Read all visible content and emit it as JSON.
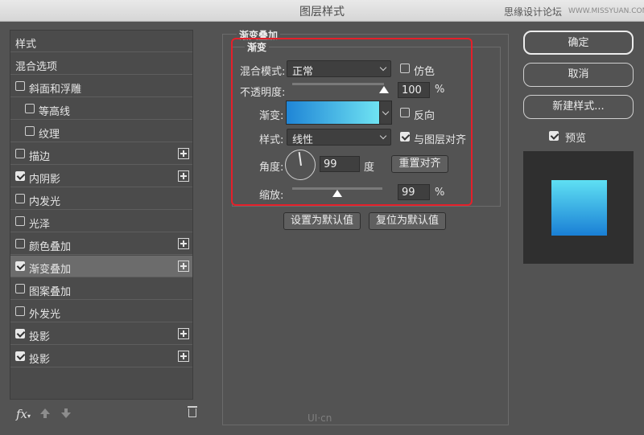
{
  "window": {
    "title": "图层样式",
    "watermark_site": "思缘设计论坛",
    "watermark_url": "WWW.MISSYUAN.COM",
    "bottom_watermark": "UI·cn"
  },
  "sidebar": {
    "items": [
      {
        "label": "样式",
        "checkbox": false,
        "checked": false,
        "plus": false,
        "indent": false,
        "selected": false
      },
      {
        "label": "混合选项",
        "checkbox": false,
        "checked": false,
        "plus": false,
        "indent": false,
        "selected": false
      },
      {
        "label": "斜面和浮雕",
        "checkbox": true,
        "checked": false,
        "plus": false,
        "indent": false,
        "selected": false
      },
      {
        "label": "等高线",
        "checkbox": true,
        "checked": false,
        "plus": false,
        "indent": true,
        "selected": false
      },
      {
        "label": "纹理",
        "checkbox": true,
        "checked": false,
        "plus": false,
        "indent": true,
        "selected": false
      },
      {
        "label": "描边",
        "checkbox": true,
        "checked": false,
        "plus": true,
        "indent": false,
        "selected": false
      },
      {
        "label": "内阴影",
        "checkbox": true,
        "checked": true,
        "plus": true,
        "indent": false,
        "selected": false
      },
      {
        "label": "内发光",
        "checkbox": true,
        "checked": false,
        "plus": false,
        "indent": false,
        "selected": false
      },
      {
        "label": "光泽",
        "checkbox": true,
        "checked": false,
        "plus": false,
        "indent": false,
        "selected": false
      },
      {
        "label": "颜色叠加",
        "checkbox": true,
        "checked": false,
        "plus": true,
        "indent": false,
        "selected": false
      },
      {
        "label": "渐变叠加",
        "checkbox": true,
        "checked": true,
        "plus": true,
        "indent": false,
        "selected": true
      },
      {
        "label": "图案叠加",
        "checkbox": true,
        "checked": false,
        "plus": false,
        "indent": false,
        "selected": false
      },
      {
        "label": "外发光",
        "checkbox": true,
        "checked": false,
        "plus": false,
        "indent": false,
        "selected": false
      },
      {
        "label": "投影",
        "checkbox": true,
        "checked": true,
        "plus": true,
        "indent": false,
        "selected": false
      },
      {
        "label": "投影",
        "checkbox": true,
        "checked": true,
        "plus": true,
        "indent": false,
        "selected": false
      }
    ],
    "fx_label": "fx"
  },
  "gradient_overlay": {
    "section_title": "渐变叠加",
    "group_title": "渐变",
    "blend_mode_label": "混合模式:",
    "blend_mode_value": "正常",
    "dither_label": "仿色",
    "dither_checked": false,
    "opacity_label": "不透明度:",
    "opacity_value": "100",
    "opacity_fraction": 1.0,
    "percent": "%",
    "gradient_label": "渐变:",
    "gradient_colors": [
      "#1f85d6",
      "#6fe3f2"
    ],
    "reverse_label": "反向",
    "reverse_checked": false,
    "style_label": "样式:",
    "style_value": "线性",
    "align_label": "与图层对齐",
    "align_checked": true,
    "angle_label": "角度:",
    "angle_value": "99",
    "degree_unit": "度",
    "reset_align_button": "重置对齐",
    "scale_label": "缩放:",
    "scale_value": "99",
    "scale_fraction": 0.5,
    "make_default_button": "设置为默认值",
    "reset_default_button": "复位为默认值"
  },
  "actions": {
    "ok": "确定",
    "cancel": "取消",
    "new_style": "新建样式...",
    "preview_label": "预览",
    "preview_checked": true
  }
}
